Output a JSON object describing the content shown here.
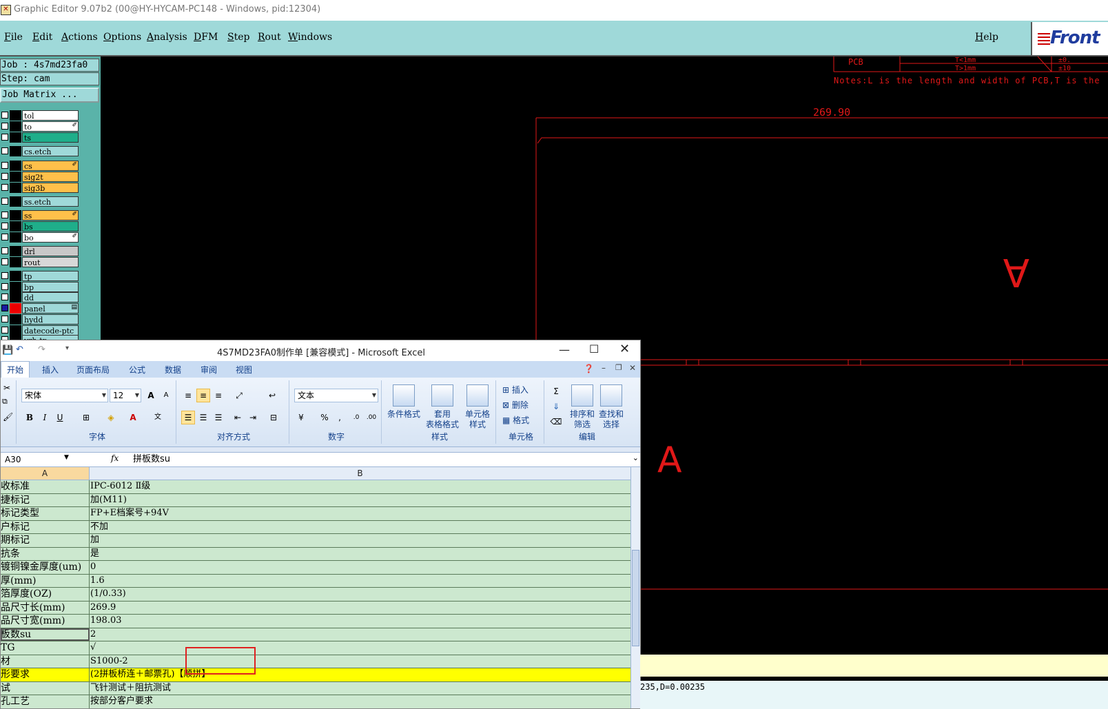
{
  "window_title": "Graphic Editor 9.07b2 (00@HY-HYCAM-PC148 - Windows, pid:12304)",
  "menu": [
    "File",
    "Edit",
    "Actions",
    "Options",
    "Analysis",
    "DFM",
    "Step",
    "Rout",
    "Windows"
  ],
  "help_label": "Help",
  "logo_text_a": "Front",
  "job": {
    "job_line": "Job : 4s7md23fa0",
    "step_line": "Step: cam",
    "matrix_button": "Job Matrix ..."
  },
  "layers": [
    {
      "name": "tol",
      "color": "#ffffff",
      "flag": ""
    },
    {
      "name": "to",
      "color": "#ffffff",
      "flag": "✐"
    },
    {
      "name": "ts",
      "color": "#1fae8a",
      "flag": ""
    },
    {
      "name": "cs.etch",
      "color": "#9fd9d9",
      "flag": ""
    },
    {
      "name": "cs",
      "color": "#ffc04a",
      "flag": "✐"
    },
    {
      "name": "sig2t",
      "color": "#ffc04a",
      "flag": ""
    },
    {
      "name": "sig3b",
      "color": "#ffc04a",
      "flag": ""
    },
    {
      "name": "ss.etch",
      "color": "#9fd9d9",
      "flag": ""
    },
    {
      "name": "ss",
      "color": "#ffc04a",
      "flag": "✐"
    },
    {
      "name": "bs",
      "color": "#1fae8a",
      "flag": ""
    },
    {
      "name": "bo",
      "color": "#ffffff",
      "flag": "✐"
    },
    {
      "name": "drl",
      "color": "#c8c8c8",
      "flag": ""
    },
    {
      "name": "rout",
      "color": "#d8d8d8",
      "flag": ""
    },
    {
      "name": "tp",
      "color": "#9fd9d9",
      "flag": ""
    },
    {
      "name": "bp",
      "color": "#9fd9d9",
      "flag": ""
    },
    {
      "name": "dd",
      "color": "#9fd9d9",
      "flag": ""
    },
    {
      "name": "panel",
      "color": "#9fd9d9",
      "flag": "▤"
    },
    {
      "name": "hydd",
      "color": "#9fd9d9",
      "flag": ""
    },
    {
      "name": "datecode-ptc",
      "color": "#9fd9d9",
      "flag": ""
    },
    {
      "name": "vrh-tp",
      "color": "#9fd9d9",
      "flag": ""
    }
  ],
  "cam": {
    "notes": "Notes:L is the length and width of PCB,T is the",
    "pcb_label": "PCB",
    "table_text_1": "T<1mm",
    "table_text_2": "T>1mm",
    "table_text_3": "±0.",
    "table_text_4": "±10",
    "dimension": "269.90",
    "letter_a": "A",
    "letter_a_right": "A",
    "status_text": "235,D=0.00235"
  },
  "excel": {
    "title": "4S7MD23FA0制作单  [兼容模式] - Microsoft Excel",
    "tabs": [
      "开始",
      "插入",
      "页面布局",
      "公式",
      "数据",
      "审阅",
      "视图"
    ],
    "font_name": "宋体",
    "font_size": "12",
    "number_format": "文本",
    "groups": {
      "font": "字体",
      "align": "对齐方式",
      "number": "数字",
      "style": "样式",
      "cells": "单元格",
      "edit": "编辑"
    },
    "style_buttons": [
      "条件格式",
      "套用\n表格格式",
      "单元格\n样式"
    ],
    "cell_buttons": [
      "插入",
      "删除",
      "格式"
    ],
    "edit_buttons": [
      "排序和\n筛选",
      "查找和\n选择"
    ],
    "name_box": "A30",
    "fx": "fx",
    "formula_value": "拼板数su",
    "col_a": "A",
    "col_b": "B",
    "rows": [
      {
        "a": "收标准",
        "b": "IPC-6012 Ⅱ级"
      },
      {
        "a": "捷标记",
        "b": "加(M11)"
      },
      {
        "a": "标记类型",
        "b": "FP+E档案号+94V"
      },
      {
        "a": "户标记",
        "b": "不加"
      },
      {
        "a": "期标记",
        "b": "加"
      },
      {
        "a": "抗条",
        "b": "是"
      },
      {
        "a": "镀铜镍金厚度(um)",
        "b": "0"
      },
      {
        "a": "厚(mm)",
        "b": "1.6"
      },
      {
        "a": "箔厚度(OZ)",
        "b": "(1/0.33)"
      },
      {
        "a": "品尺寸长(mm)",
        "b": "269.9"
      },
      {
        "a": "品尺寸宽(mm)",
        "b": "198.03"
      },
      {
        "a": "板数su",
        "b": "2"
      },
      {
        "a": "TG",
        "b": "√"
      },
      {
        "a": "材",
        "b": "S1000-2"
      },
      {
        "a": "形要求",
        "b": "(2拼板桥连＋邮票孔)【顺拼】"
      },
      {
        "a": "试",
        "b": "飞针测试＋阻抗测试"
      },
      {
        "a": "孔工艺",
        "b": "按部分客户要求"
      }
    ]
  }
}
